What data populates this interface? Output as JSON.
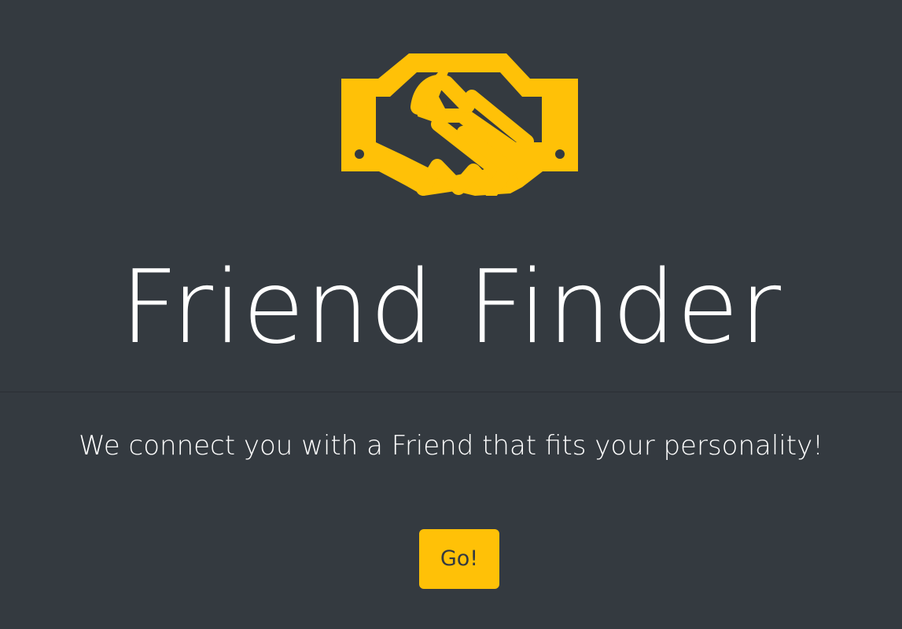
{
  "hero": {
    "logo_icon": "handshake-icon",
    "title": "Friend Finder",
    "accent_color": "#ffc107",
    "background_color": "#343a40"
  },
  "main": {
    "tagline": "We connect you with a Friend that fits your personality!",
    "go_button_label": "Go!"
  }
}
